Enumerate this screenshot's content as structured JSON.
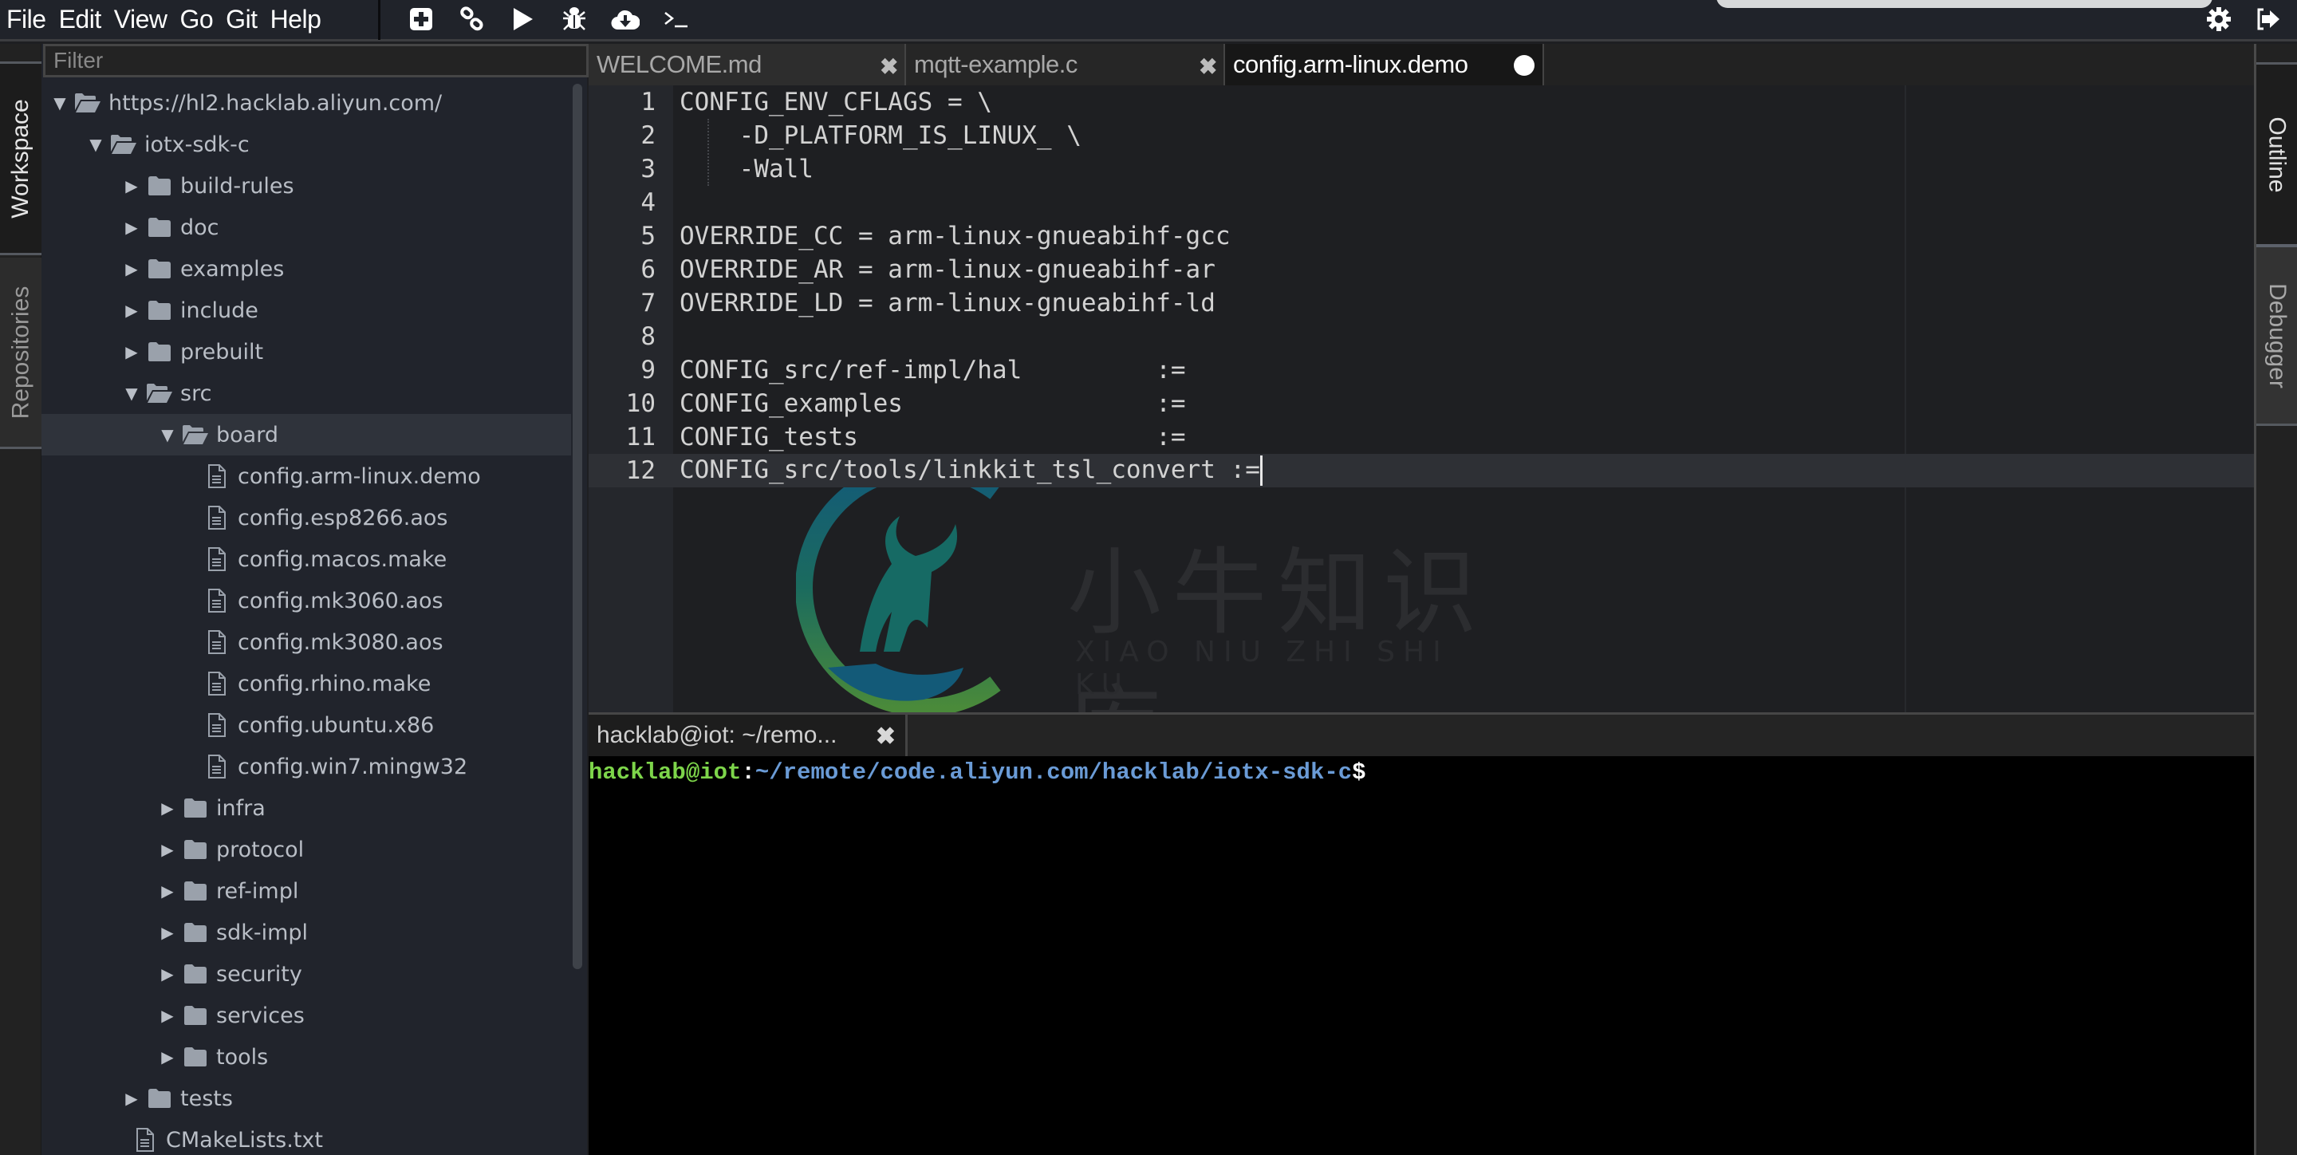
{
  "menubar": {
    "menus": [
      "File",
      "Edit",
      "View",
      "Go",
      "Git",
      "Help"
    ],
    "tools": [
      {
        "name": "new-file-icon",
        "label": "New"
      },
      {
        "name": "link-icon",
        "label": "Link"
      },
      {
        "name": "run-icon",
        "label": "Run"
      },
      {
        "name": "debug-icon",
        "label": "Debug"
      },
      {
        "name": "cloud-download-icon",
        "label": "Download"
      },
      {
        "name": "terminal-icon",
        "label": "Terminal"
      }
    ],
    "right_tools": [
      {
        "name": "gear-icon",
        "label": "Settings"
      },
      {
        "name": "sign-out-icon",
        "label": "Sign out"
      }
    ]
  },
  "left_strip": {
    "tabs": [
      {
        "label": "Workspace",
        "active": true
      },
      {
        "label": "Repositories",
        "active": false
      }
    ]
  },
  "right_strip": {
    "tabs": [
      {
        "label": "Outline",
        "active": true
      },
      {
        "label": "Debugger",
        "active": false
      }
    ]
  },
  "explorer": {
    "filter_placeholder": "Filter",
    "filter_value": "",
    "tree": [
      {
        "label": "https://hl2.hacklab.aliyun.com/",
        "type": "folder",
        "expanded": true,
        "depth": 0
      },
      {
        "label": "iotx-sdk-c",
        "type": "folder",
        "expanded": true,
        "depth": 1
      },
      {
        "label": "build-rules",
        "type": "folder",
        "expanded": false,
        "depth": 2
      },
      {
        "label": "doc",
        "type": "folder",
        "expanded": false,
        "depth": 2
      },
      {
        "label": "examples",
        "type": "folder",
        "expanded": false,
        "depth": 2
      },
      {
        "label": "include",
        "type": "folder",
        "expanded": false,
        "depth": 2
      },
      {
        "label": "prebuilt",
        "type": "folder",
        "expanded": false,
        "depth": 2
      },
      {
        "label": "src",
        "type": "folder",
        "expanded": true,
        "depth": 2
      },
      {
        "label": "board",
        "type": "folder",
        "expanded": true,
        "depth": 3,
        "selected": true
      },
      {
        "label": "config.arm-linux.demo",
        "type": "file",
        "depth": 4
      },
      {
        "label": "config.esp8266.aos",
        "type": "file",
        "depth": 4
      },
      {
        "label": "config.macos.make",
        "type": "file",
        "depth": 4
      },
      {
        "label": "config.mk3060.aos",
        "type": "file",
        "depth": 4
      },
      {
        "label": "config.mk3080.aos",
        "type": "file",
        "depth": 4
      },
      {
        "label": "config.rhino.make",
        "type": "file",
        "depth": 4
      },
      {
        "label": "config.ubuntu.x86",
        "type": "file",
        "depth": 4
      },
      {
        "label": "config.win7.mingw32",
        "type": "file",
        "depth": 4
      },
      {
        "label": "infra",
        "type": "folder",
        "expanded": false,
        "depth": 3
      },
      {
        "label": "protocol",
        "type": "folder",
        "expanded": false,
        "depth": 3
      },
      {
        "label": "ref-impl",
        "type": "folder",
        "expanded": false,
        "depth": 3
      },
      {
        "label": "sdk-impl",
        "type": "folder",
        "expanded": false,
        "depth": 3
      },
      {
        "label": "security",
        "type": "folder",
        "expanded": false,
        "depth": 3
      },
      {
        "label": "services",
        "type": "folder",
        "expanded": false,
        "depth": 3
      },
      {
        "label": "tools",
        "type": "folder",
        "expanded": false,
        "depth": 3
      },
      {
        "label": "tests",
        "type": "folder",
        "expanded": false,
        "depth": 2
      },
      {
        "label": "CMakeLists.txt",
        "type": "file",
        "depth": 2
      }
    ]
  },
  "editor": {
    "tabs": [
      {
        "label": "WELCOME.md",
        "active": false,
        "dirty": false
      },
      {
        "label": "mqtt-example.c",
        "active": false,
        "dirty": false
      },
      {
        "label": "config.arm-linux.demo",
        "active": true,
        "dirty": true
      }
    ],
    "active_line": 12,
    "lines": [
      {
        "num": "1",
        "text": "CONFIG_ENV_CFLAGS = \\"
      },
      {
        "num": "2",
        "text": "    -D_PLATFORM_IS_LINUX_ \\"
      },
      {
        "num": "3",
        "text": "    -Wall"
      },
      {
        "num": "4",
        "text": ""
      },
      {
        "num": "5",
        "text": "OVERRIDE_CC = arm-linux-gnueabihf-gcc"
      },
      {
        "num": "6",
        "text": "OVERRIDE_AR = arm-linux-gnueabihf-ar"
      },
      {
        "num": "7",
        "text": "OVERRIDE_LD = arm-linux-gnueabihf-ld"
      },
      {
        "num": "8",
        "text": ""
      },
      {
        "num": "9",
        "text": "CONFIG_src/ref-impl/hal         :="
      },
      {
        "num": "10",
        "text": "CONFIG_examples                 :="
      },
      {
        "num": "11",
        "text": "CONFIG_tests                    :="
      },
      {
        "num": "12",
        "text": "CONFIG_src/tools/linkkit_tsl_convert :="
      }
    ],
    "watermark": {
      "title_cn": "小牛知识库",
      "subtitle": "XIAO NIU ZHI SHI KU"
    }
  },
  "terminal": {
    "tab_label": "hacklab@iot: ~/remo...",
    "prompt_user": "hacklab@iot",
    "prompt_colon": ":",
    "prompt_path": "~/remote/code.aliyun.com/hacklab/iotx-sdk-c",
    "prompt_symbol": "$"
  },
  "colors": {
    "menubar_bg": "#20232a",
    "explorer_bg": "#21242c",
    "editor_bg": "#1e1f22",
    "terminal_bg": "#000000",
    "terminal_user": "#7dd54a",
    "terminal_path": "#6a9bd6",
    "watermark_green": "#4a8a3a",
    "watermark_teal": "#135a78"
  }
}
